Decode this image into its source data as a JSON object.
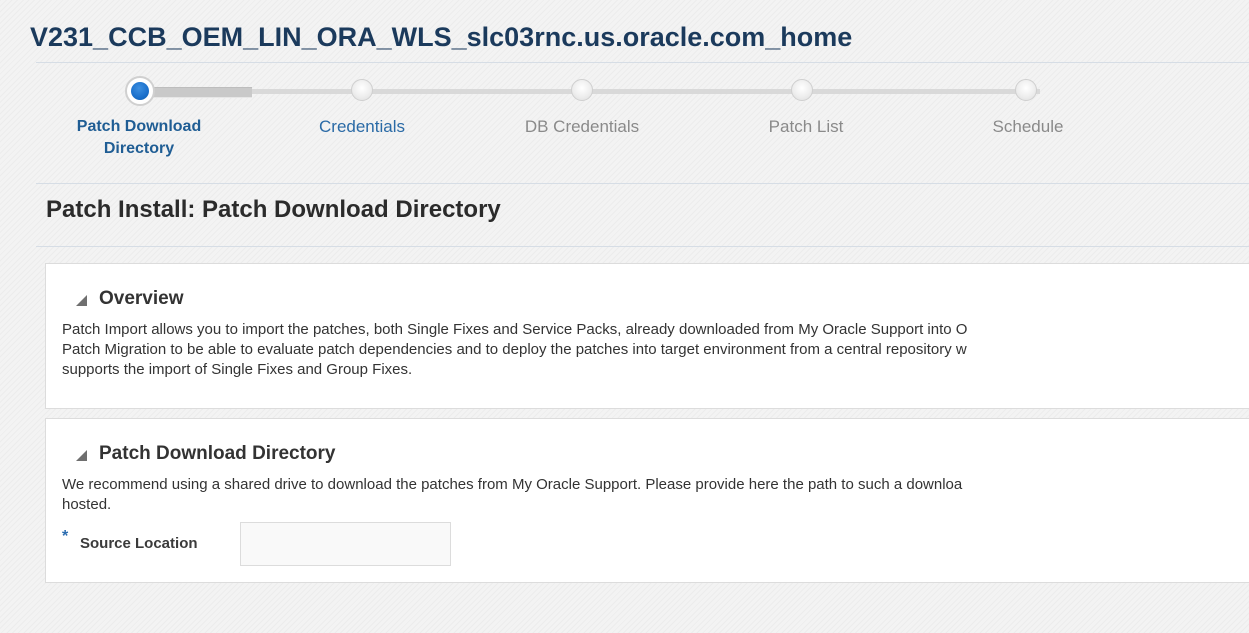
{
  "window": {
    "title": "V231_CCB_OEM_LIN_ORA_WLS_slc03rnc.us.oracle.com_home"
  },
  "train": {
    "steps": [
      {
        "line1": "Patch Download",
        "line2": "Directory",
        "state": "current"
      },
      {
        "line1": "Credentials",
        "line2": "",
        "state": "visited"
      },
      {
        "line1": "DB Credentials",
        "line2": "",
        "state": "disabled"
      },
      {
        "line1": "Patch List",
        "line2": "",
        "state": "disabled"
      },
      {
        "line1": "Schedule",
        "line2": "",
        "state": "disabled"
      }
    ]
  },
  "page": {
    "heading": "Patch Install: Patch Download Directory"
  },
  "overview": {
    "title": "Overview",
    "lines": [
      "Patch Import allows you to import the patches, both Single Fixes and Service Packs, already downloaded from My Oracle Support into O",
      "Patch Migration to be able to evaluate patch dependencies and to deploy the patches into target environment from a central repository w",
      "supports the import of Single Fixes and Group Fixes."
    ]
  },
  "download_dir": {
    "title": "Patch Download Directory",
    "lines": [
      "We recommend using a shared drive to download the patches from My Oracle Support. Please provide here the path to such a downloa",
      "hosted."
    ],
    "required_marker": "*",
    "source_location_label": "Source Location",
    "source_location_value": ""
  },
  "colors": {
    "title": "#1b3a5c",
    "current_step": "#1a6fcb",
    "link": "#2a6aa6",
    "disabled": "#8a8a8a"
  }
}
